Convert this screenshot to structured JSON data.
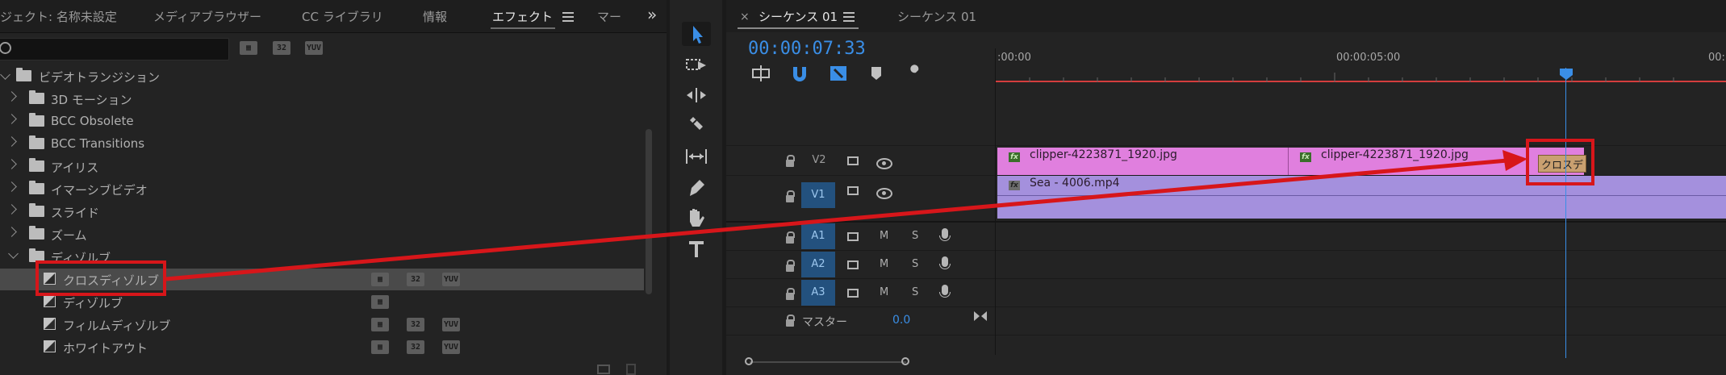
{
  "effects": {
    "tabs": [
      "ジェクト: 名称未設定",
      "メディアブラウザー",
      "CC ライブラリ",
      "情報",
      "エフェクト",
      "マー"
    ],
    "active_tab": "エフェクト",
    "more": "»",
    "search_placeholder": "",
    "badges": [
      "32",
      "YUV"
    ],
    "tree": [
      {
        "label": "ビデオトランジション",
        "type": "folder",
        "open": true
      },
      {
        "label": "3D モーション",
        "type": "folder"
      },
      {
        "label": "BCC Obsolete",
        "type": "folder"
      },
      {
        "label": "BCC Transitions",
        "type": "folder"
      },
      {
        "label": "アイリス",
        "type": "folder"
      },
      {
        "label": "イマーシブビデオ",
        "type": "folder"
      },
      {
        "label": "スライド",
        "type": "folder"
      },
      {
        "label": "ズーム",
        "type": "folder"
      },
      {
        "label": "ディゾルブ",
        "type": "folder",
        "open": true
      },
      {
        "label": "クロスディゾルブ",
        "type": "effect",
        "selected": true
      },
      {
        "label": "ディゾルブ",
        "type": "effect"
      },
      {
        "label": "フィルムディゾルブ",
        "type": "effect"
      },
      {
        "label": "ホワイトアウト",
        "type": "effect"
      }
    ]
  },
  "sequence": {
    "close": "×",
    "tab_active": "シーケンス 01",
    "tab_other": "シーケンス 01",
    "timecode": "00:00:07:33",
    "ruler_labels": [
      ":00:00",
      "00:00:05:00",
      "00:"
    ],
    "tracks": {
      "v2": "V2",
      "v1": "V1",
      "a1": "A1",
      "a2": "A2",
      "a3": "A3",
      "master_label": "マスター",
      "master_value": "0.0",
      "m": "M",
      "s": "S"
    },
    "clips": {
      "v2_clip_a": "clipper-4223871_1920.jpg",
      "v2_clip_b": "clipper-4223871_1920.jpg",
      "transition": "クロスデ",
      "v1_clip": "Sea - 4006.mp4",
      "fx": "fx"
    }
  },
  "colors": {
    "accent_blue": "#3a8ee6",
    "annotation_red": "#d7161a",
    "clip_pink": "#e07fde",
    "clip_purple": "#a490dd"
  }
}
